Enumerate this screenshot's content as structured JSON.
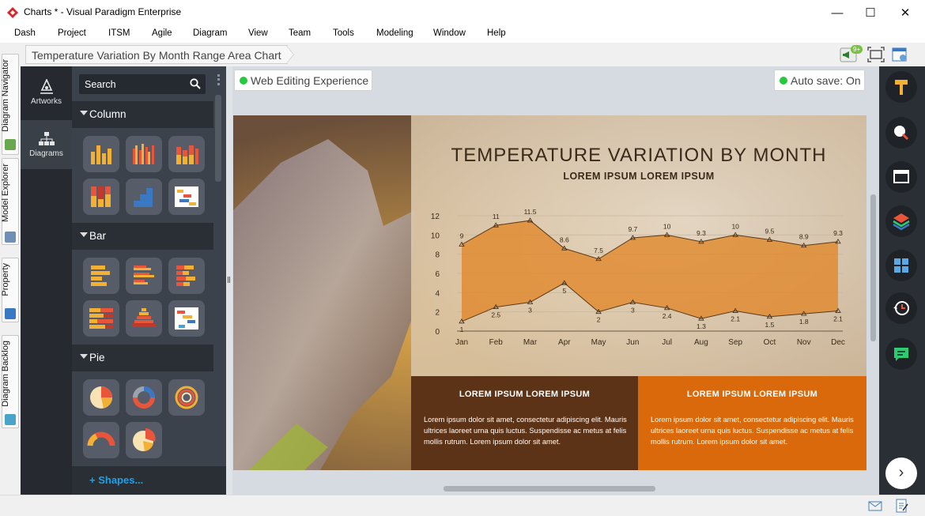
{
  "window": {
    "title": "Charts * - Visual Paradigm Enterprise",
    "minimize": "—",
    "maximize": "☐",
    "close": "✕"
  },
  "menu": [
    "Dash",
    "Project",
    "ITSM",
    "Agile",
    "Diagram",
    "View",
    "Team",
    "Tools",
    "Modeling",
    "Window",
    "Help"
  ],
  "breadcrumb": "Temperature Variation By Month Range Area Chart",
  "notification_badge": "9+",
  "left_tabs": [
    "Diagram Navigator",
    "Model Explorer",
    "Property",
    "Diagram Backlog"
  ],
  "categories": [
    {
      "label": "Artworks",
      "icon": "artworks-icon"
    },
    {
      "label": "Diagrams",
      "icon": "diagrams-icon"
    }
  ],
  "search": {
    "placeholder": "Search"
  },
  "sections": [
    {
      "title": "Column"
    },
    {
      "title": "Bar"
    },
    {
      "title": "Pie"
    }
  ],
  "shapes_link": "+ Shapes...",
  "pills": {
    "web_editing": "Web Editing Experience",
    "autosave": "Auto save: On"
  },
  "colors": {
    "accent_green": "#27c93f",
    "area_fill": "#e08a2e",
    "box_dark": "#5c3317",
    "box_orange": "#d9690a",
    "link_blue": "#1ea0e8"
  },
  "chart_data": {
    "type": "area",
    "title": "TEMPERATURE VARIATION BY MONTH",
    "subtitle": "LOREM IPSUM LOREM IPSUM",
    "categories": [
      "Jan",
      "Feb",
      "Mar",
      "Apr",
      "May",
      "Jun",
      "Jul",
      "Aug",
      "Sep",
      "Oct",
      "Nov",
      "Dec"
    ],
    "series": [
      {
        "name": "",
        "values": [
          9,
          11,
          11.5,
          8.6,
          7.5,
          9.7,
          10,
          9.3,
          10,
          9.5,
          8.9,
          9.3
        ]
      },
      {
        "name": "",
        "values": [
          1,
          2.5,
          3,
          5,
          2,
          3,
          2.4,
          1.3,
          2.1,
          1.5,
          1.8,
          2.1
        ]
      }
    ],
    "high_labels": [
      "9",
      "11",
      "11.5",
      "8.6",
      "7.5",
      "9.7",
      "10",
      "9.3",
      "10",
      "9.5",
      "8.9",
      "9.3"
    ],
    "low_labels": [
      "1",
      "2.5",
      "3",
      "5",
      "2",
      "3",
      "2.4",
      "1.3",
      "2.1",
      "1.5",
      "1.8",
      "2.1"
    ],
    "yticks": [
      "0",
      "2",
      "4",
      "6",
      "8",
      "10",
      "12"
    ],
    "ylim": [
      0,
      12
    ],
    "grid": true
  },
  "info_boxes": [
    {
      "title": "LOREM IPSUM LOREM IPSUM",
      "text": "Lorem ipsum dolor sit amet, consectetur adipiscing elit. Mauris ultrices laoreet urna quis luctus. Suspendisse ac metus at felis mollis rutrum. Lorem ipsum dolor sit amet."
    },
    {
      "title": "LOREM IPSUM LOREM IPSUM",
      "text": "Lorem ipsum dolor sit amet, consectetur adipiscing elit. Mauris ultrices laoreet urna quis luctus. Suspendisse ac metus at felis mollis rutrum. Lorem ipsum dolor sit amet."
    }
  ],
  "right_toolbar": [
    "format-brush-icon",
    "zoom-icon",
    "window-icon",
    "layers-icon",
    "panels-icon",
    "history-icon",
    "chat-icon"
  ],
  "next_button": "›"
}
